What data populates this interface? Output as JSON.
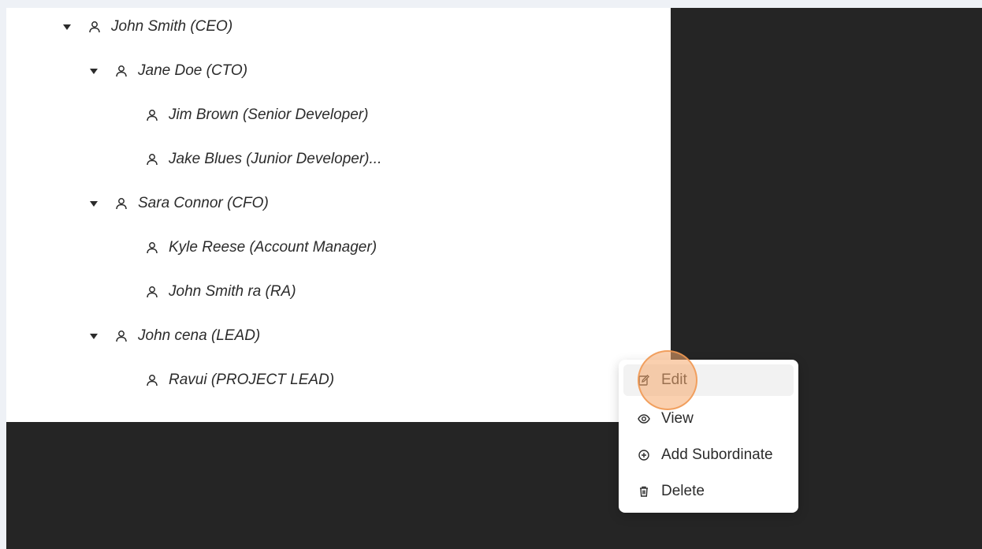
{
  "tree": {
    "nodes": [
      {
        "name": "John Smith (CEO)",
        "expanded": true,
        "icon": "person-icon"
      },
      {
        "name": "Jane Doe (CTO)",
        "expanded": true,
        "icon": "person-icon"
      },
      {
        "name": "Jim Brown (Senior Developer)",
        "icon": "person-icon"
      },
      {
        "name": "Jake Blues (Junior Developer)...",
        "icon": "person-icon"
      },
      {
        "name": "Sara Connor (CFO)",
        "expanded": true,
        "icon": "person-icon"
      },
      {
        "name": "Kyle Reese (Account Manager)",
        "icon": "person-icon"
      },
      {
        "name": "John Smith ra (RA)",
        "icon": "person-icon"
      },
      {
        "name": "John cena (LEAD)",
        "expanded": true,
        "icon": "person-icon"
      },
      {
        "name": "Ravui (PROJECT LEAD)",
        "icon": "person-icon"
      }
    ]
  },
  "context_menu": {
    "items": [
      {
        "label": "Edit",
        "icon": "edit-icon",
        "highlighted": true
      },
      {
        "label": "View",
        "icon": "eye-icon"
      },
      {
        "label": "Add Subordinate",
        "icon": "plus-circle-icon"
      },
      {
        "label": "Delete",
        "icon": "trash-icon"
      }
    ]
  },
  "colors": {
    "page_background": "#eef1f6",
    "dark_backdrop": "#252525",
    "panel": "#ffffff",
    "text": "#2b2b2b",
    "click_highlight": "#f5aa6e"
  }
}
